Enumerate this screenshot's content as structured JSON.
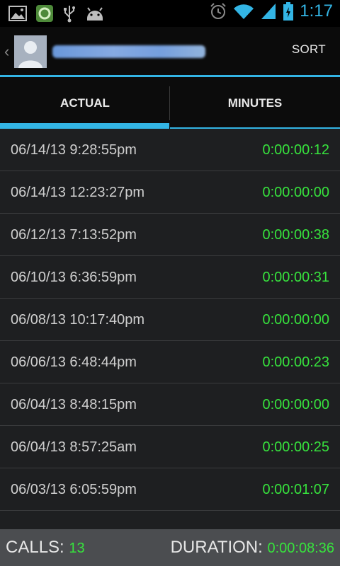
{
  "status_bar": {
    "time": "1:17",
    "icons": [
      "gallery-icon",
      "app-icon",
      "usb-icon",
      "android-icon",
      "alarm-icon",
      "wifi-icon",
      "signal-icon",
      "battery-icon"
    ]
  },
  "action_bar": {
    "sort_label": "SORT"
  },
  "tabs": [
    {
      "label": "ACTUAL",
      "selected": true
    },
    {
      "label": "MINUTES",
      "selected": false
    }
  ],
  "calls": [
    {
      "datetime": "06/14/13 9:28:55pm",
      "duration": "0:00:00:12"
    },
    {
      "datetime": "06/14/13 12:23:27pm",
      "duration": "0:00:00:00"
    },
    {
      "datetime": "06/12/13 7:13:52pm",
      "duration": "0:00:00:38"
    },
    {
      "datetime": "06/10/13 6:36:59pm",
      "duration": "0:00:00:31"
    },
    {
      "datetime": "06/08/13 10:17:40pm",
      "duration": "0:00:00:00"
    },
    {
      "datetime": "06/06/13 6:48:44pm",
      "duration": "0:00:00:23"
    },
    {
      "datetime": "06/04/13 8:48:15pm",
      "duration": "0:00:00:00"
    },
    {
      "datetime": "06/04/13 8:57:25am",
      "duration": "0:00:00:25"
    },
    {
      "datetime": "06/03/13 6:05:59pm",
      "duration": "0:00:01:07"
    }
  ],
  "footer": {
    "calls_label": "CALLS:",
    "calls_value": "13",
    "duration_label": "DURATION:",
    "duration_value": "0:00:08:36"
  },
  "colors": {
    "accent": "#33b5e5",
    "duration_green": "#37e23d"
  }
}
